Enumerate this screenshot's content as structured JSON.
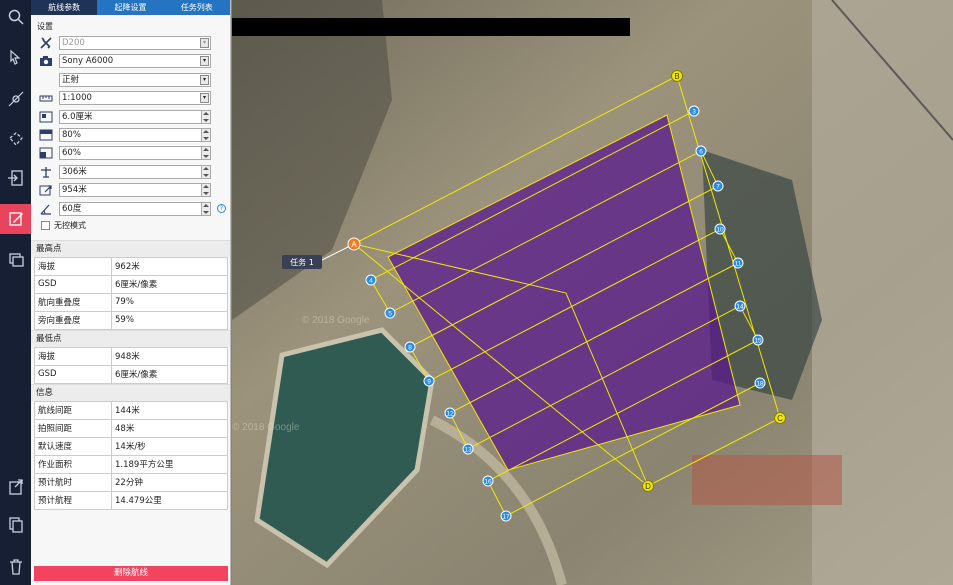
{
  "tabs": [
    "航线参数",
    "起降设置",
    "任务列表"
  ],
  "settings": {
    "title": "设置",
    "aircraft": "D200",
    "camera": "Sony A6000",
    "shoot_mode": "正射",
    "scale": "1:1000",
    "gsd": "6.0厘米",
    "forward_overlap": "80%",
    "side_overlap": "60%",
    "altitude": "306米",
    "takeoff_altitude": "954米",
    "angle": "60度",
    "help": "?",
    "no_control_mode": "无控模式"
  },
  "highest_point": {
    "title": "最高点",
    "rows": [
      [
        "海拔",
        "962米"
      ],
      [
        "GSD",
        "6厘米/像素"
      ],
      [
        "航向重叠度",
        "79%"
      ],
      [
        "旁向重叠度",
        "59%"
      ]
    ]
  },
  "lowest_point": {
    "title": "最低点",
    "rows": [
      [
        "海拔",
        "948米"
      ],
      [
        "GSD",
        "6厘米/像素"
      ]
    ]
  },
  "info": {
    "title": "信息",
    "rows": [
      [
        "航线间距",
        "144米"
      ],
      [
        "拍照间距",
        "48米"
      ],
      [
        "默认速度",
        "14米/秒"
      ],
      [
        "作业面积",
        "1.189平方公里"
      ],
      [
        "预计航时",
        "22分钟"
      ],
      [
        "预计航程",
        "14.479公里"
      ]
    ]
  },
  "delete_button": "删除航线",
  "map": {
    "task_label": "任务 1",
    "watermark": "© 2018 Google",
    "corners": [
      "A",
      "B",
      "C",
      "D"
    ],
    "waypoints": [
      "3",
      "4",
      "5",
      "6",
      "7",
      "8",
      "9",
      "10",
      "11",
      "12",
      "13",
      "14",
      "15",
      "16",
      "17",
      "18"
    ],
    "colors": {
      "polygon": "#5a1a8c",
      "route": "#f2e800",
      "waypoint": "#2a8be0",
      "start": "#f07a22"
    }
  }
}
